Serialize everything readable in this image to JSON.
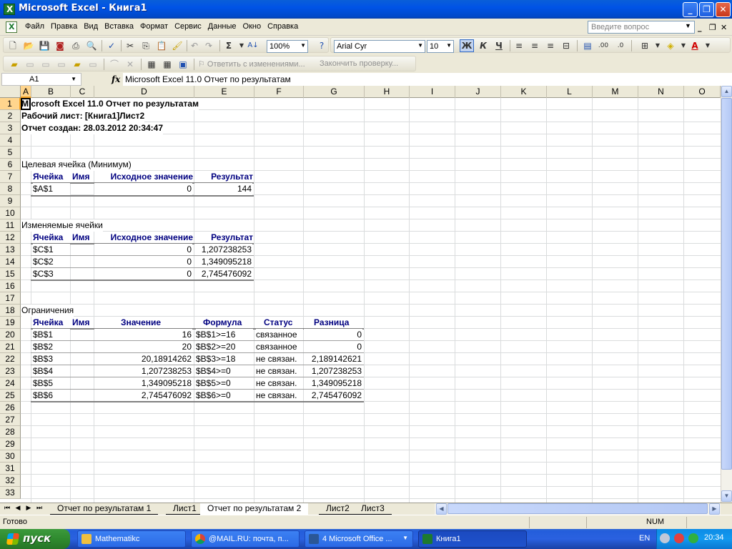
{
  "window": {
    "title": "Microsoft Excel - Книга1"
  },
  "menu": {
    "items": [
      "Файл",
      "Правка",
      "Вид",
      "Вставка",
      "Формат",
      "Сервис",
      "Данные",
      "Окно",
      "Справка"
    ],
    "help_placeholder": "Введите вопрос"
  },
  "toolbar": {
    "zoom": "100%",
    "font_name": "Arial Cyr",
    "font_size": "10",
    "bold": "Ж",
    "italic": "К",
    "underline": "Ч",
    "reply_changes": "Ответить с изменениями...",
    "end_review": "Закончить проверку..."
  },
  "formula_bar": {
    "name_box": "A1",
    "fx": "fx",
    "content": "Microsoft Excel 11.0 Отчет по результатам"
  },
  "columns": [
    "A",
    "B",
    "C",
    "D",
    "E",
    "F",
    "G",
    "H",
    "I",
    "J",
    "K",
    "L",
    "M",
    "N",
    "O"
  ],
  "rows": [
    "1",
    "2",
    "3",
    "4",
    "5",
    "6",
    "7",
    "8",
    "9",
    "10",
    "11",
    "12",
    "13",
    "14",
    "15",
    "16",
    "17",
    "18",
    "19",
    "20",
    "21",
    "22",
    "23",
    "24",
    "25",
    "26",
    "27",
    "28",
    "29",
    "30",
    "31",
    "32",
    "33"
  ],
  "report": {
    "line1": "Microsoft Excel 11.0 Отчет по результатам",
    "line2": "Рабочий лист: [Книга1]Лист2",
    "line3": "Отчет создан: 28.03.2012 20:34:47",
    "target_title": "Целевая ячейка (Минимум)",
    "target_headers": [
      "Ячейка",
      "Имя",
      "Исходное значение",
      "Результат"
    ],
    "target_rows": [
      {
        "cell": "$A$1",
        "name": "",
        "initial": "0",
        "result": "144"
      }
    ],
    "changing_title": "Изменяемые ячейки",
    "changing_headers": [
      "Ячейка",
      "Имя",
      "Исходное значение",
      "Результат"
    ],
    "changing_rows": [
      {
        "cell": "$C$1",
        "name": "",
        "initial": "0",
        "result": "1,207238253"
      },
      {
        "cell": "$C$2",
        "name": "",
        "initial": "0",
        "result": "1,349095218"
      },
      {
        "cell": "$C$3",
        "name": "",
        "initial": "0",
        "result": "2,745476092"
      }
    ],
    "constraints_title": "Ограничения",
    "constraints_headers": [
      "Ячейка",
      "Имя",
      "Значение",
      "Формула",
      "Статус",
      "Разница"
    ],
    "constraints_rows": [
      {
        "cell": "$B$1",
        "value": "16",
        "formula": "$B$1>=16",
        "status": "связанное",
        "diff": "0"
      },
      {
        "cell": "$B$2",
        "value": "20",
        "formula": "$B$2>=20",
        "status": "связанное",
        "diff": "0"
      },
      {
        "cell": "$B$3",
        "value": "20,18914262",
        "formula": "$B$3>=18",
        "status": "не связан.",
        "diff": "2,189142621"
      },
      {
        "cell": "$B$4",
        "value": "1,207238253",
        "formula": "$B$4>=0",
        "status": "не связан.",
        "diff": "1,207238253"
      },
      {
        "cell": "$B$5",
        "value": "1,349095218",
        "formula": "$B$5>=0",
        "status": "не связан.",
        "diff": "1,349095218"
      },
      {
        "cell": "$B$6",
        "value": "2,745476092",
        "formula": "$B$6>=0",
        "status": "не связан.",
        "diff": "2,745476092"
      }
    ]
  },
  "sheet_tabs": [
    "Отчет по результатам 1",
    "Лист1",
    "Отчет по результатам 2",
    "Лист2",
    "Лист3"
  ],
  "active_tab": "Отчет по результатам 2",
  "status": {
    "ready": "Готово",
    "num": "NUM"
  },
  "taskbar": {
    "start": "пуск",
    "tasks": [
      "Mathematikc",
      "@MAIL.RU: почта, п...",
      "4 Microsoft Office ...",
      "Книга1"
    ],
    "lang": "EN",
    "clock": "20:34"
  },
  "colors": {
    "header_text": "#000080",
    "selection": "#ffd58d",
    "titlebar": "#0053e6",
    "taskbar": "#245edb",
    "start": "#2f8a2f"
  }
}
